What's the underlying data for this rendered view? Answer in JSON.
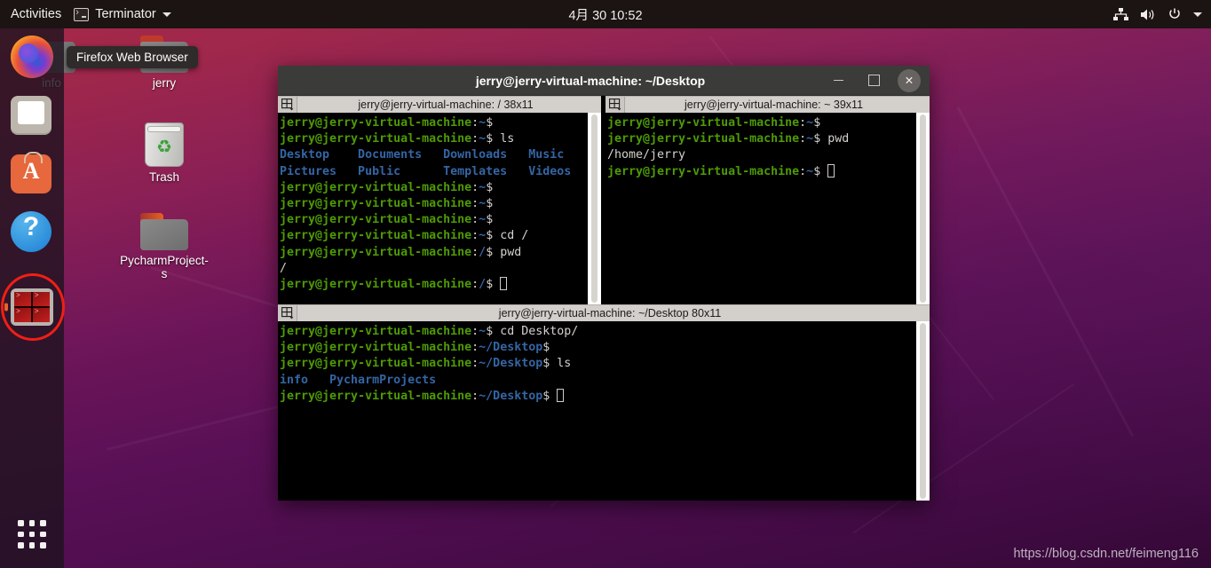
{
  "topbar": {
    "activities": "Activities",
    "app_name": "Terminator",
    "app_icon": "terminal-icon",
    "clock": "4月 30  10:52",
    "sys_icons": [
      "network-icon",
      "volume-icon",
      "power-icon",
      "chevron-down-icon"
    ]
  },
  "dock": {
    "items": [
      {
        "name": "firefox",
        "label": "Firefox Web Browser",
        "running": false,
        "selected": false
      },
      {
        "name": "files",
        "label": "Files",
        "running": false,
        "selected": false
      },
      {
        "name": "software",
        "label": "Ubuntu Software",
        "running": false,
        "selected": false
      },
      {
        "name": "help",
        "label": "Help",
        "running": false,
        "selected": false
      },
      {
        "name": "terminator",
        "label": "Terminator",
        "running": true,
        "selected": true
      }
    ],
    "show_apps_label": "Show Applications"
  },
  "tooltip": {
    "text": "Firefox Web Browser"
  },
  "desktop_icons": [
    {
      "name": "info",
      "label": "info",
      "type": "folder",
      "color": "#9b3b3b"
    },
    {
      "name": "jerry",
      "label": "jerry",
      "type": "folder",
      "color": "#e95420"
    },
    {
      "name": "trash",
      "label": "Trash",
      "type": "trash"
    },
    {
      "name": "pycharmprojects",
      "label": "PycharmProject-s",
      "type": "folder",
      "color": "#e95420"
    }
  ],
  "terminal_window": {
    "title": "jerry@jerry-virtual-machine: ~/Desktop",
    "controls": {
      "minimize": "minimize-button",
      "maximize": "maximize-button",
      "close": "close-button"
    },
    "panes": [
      {
        "id": "pane-top-left",
        "title": "jerry@jerry-virtual-machine: / 38x11",
        "lines": [
          [
            {
              "t": "jerry@jerry-virtual-machine",
              "c": "u"
            },
            {
              "t": ":",
              "c": "w"
            },
            {
              "t": "~",
              "c": "p"
            },
            {
              "t": "$",
              "c": "w"
            }
          ],
          [
            {
              "t": "jerry@jerry-virtual-machine",
              "c": "u"
            },
            {
              "t": ":",
              "c": "w"
            },
            {
              "t": "~",
              "c": "p"
            },
            {
              "t": "$ ls",
              "c": "w"
            }
          ],
          [
            {
              "t": "Desktop    Documents   Downloads   Music",
              "c": "d"
            }
          ],
          [
            {
              "t": "Pictures   Public      Templates   Videos",
              "c": "d"
            }
          ],
          [
            {
              "t": "jerry@jerry-virtual-machine",
              "c": "u"
            },
            {
              "t": ":",
              "c": "w"
            },
            {
              "t": "~",
              "c": "p"
            },
            {
              "t": "$",
              "c": "w"
            }
          ],
          [
            {
              "t": "jerry@jerry-virtual-machine",
              "c": "u"
            },
            {
              "t": ":",
              "c": "w"
            },
            {
              "t": "~",
              "c": "p"
            },
            {
              "t": "$",
              "c": "w"
            }
          ],
          [
            {
              "t": "jerry@jerry-virtual-machine",
              "c": "u"
            },
            {
              "t": ":",
              "c": "w"
            },
            {
              "t": "~",
              "c": "p"
            },
            {
              "t": "$",
              "c": "w"
            }
          ],
          [
            {
              "t": "jerry@jerry-virtual-machine",
              "c": "u"
            },
            {
              "t": ":",
              "c": "w"
            },
            {
              "t": "~",
              "c": "p"
            },
            {
              "t": "$ cd /",
              "c": "w"
            }
          ],
          [
            {
              "t": "jerry@jerry-virtual-machine",
              "c": "u"
            },
            {
              "t": ":",
              "c": "w"
            },
            {
              "t": "/",
              "c": "p"
            },
            {
              "t": "$ pwd",
              "c": "w"
            }
          ],
          [
            {
              "t": "/",
              "c": "w"
            }
          ],
          [
            {
              "t": "jerry@jerry-virtual-machine",
              "c": "u"
            },
            {
              "t": ":",
              "c": "w"
            },
            {
              "t": "/",
              "c": "p"
            },
            {
              "t": "$ ",
              "c": "w"
            },
            {
              "t": "",
              "c": "cursor"
            }
          ]
        ]
      },
      {
        "id": "pane-top-right",
        "title": "jerry@jerry-virtual-machine: ~ 39x11",
        "lines": [
          [
            {
              "t": "jerry@jerry-virtual-machine",
              "c": "u"
            },
            {
              "t": ":",
              "c": "w"
            },
            {
              "t": "~",
              "c": "p"
            },
            {
              "t": "$",
              "c": "w"
            }
          ],
          [
            {
              "t": "jerry@jerry-virtual-machine",
              "c": "u"
            },
            {
              "t": ":",
              "c": "w"
            },
            {
              "t": "~",
              "c": "p"
            },
            {
              "t": "$ pwd",
              "c": "w"
            }
          ],
          [
            {
              "t": "/home/jerry",
              "c": "w"
            }
          ],
          [
            {
              "t": "jerry@jerry-virtual-machine",
              "c": "u"
            },
            {
              "t": ":",
              "c": "w"
            },
            {
              "t": "~",
              "c": "p"
            },
            {
              "t": "$ ",
              "c": "w"
            },
            {
              "t": "",
              "c": "cursor"
            }
          ]
        ]
      },
      {
        "id": "pane-bottom",
        "title": "jerry@jerry-virtual-machine: ~/Desktop 80x11",
        "lines": [
          [
            {
              "t": "jerry@jerry-virtual-machine",
              "c": "u"
            },
            {
              "t": ":",
              "c": "w"
            },
            {
              "t": "~",
              "c": "p"
            },
            {
              "t": "$ cd Desktop/",
              "c": "w"
            }
          ],
          [
            {
              "t": "jerry@jerry-virtual-machine",
              "c": "u"
            },
            {
              "t": ":",
              "c": "w"
            },
            {
              "t": "~/Desktop",
              "c": "p"
            },
            {
              "t": "$",
              "c": "w"
            }
          ],
          [
            {
              "t": "jerry@jerry-virtual-machine",
              "c": "u"
            },
            {
              "t": ":",
              "c": "w"
            },
            {
              "t": "~/Desktop",
              "c": "p"
            },
            {
              "t": "$ ls",
              "c": "w"
            }
          ],
          [
            {
              "t": "info   PycharmProjects",
              "c": "d"
            }
          ],
          [
            {
              "t": "jerry@jerry-virtual-machine",
              "c": "u"
            },
            {
              "t": ":",
              "c": "w"
            },
            {
              "t": "~/Desktop",
              "c": "p"
            },
            {
              "t": "$ ",
              "c": "w"
            },
            {
              "t": "",
              "c": "cursor"
            }
          ]
        ]
      }
    ]
  },
  "watermark": {
    "text": "https://blog.csdn.net/feimeng116"
  },
  "colors": {
    "accent_orange": "#e95420",
    "prompt_green": "#4e9a06",
    "prompt_blue": "#3465a4",
    "terminal_bg": "#000000",
    "selection_ring": "#f01f14"
  }
}
